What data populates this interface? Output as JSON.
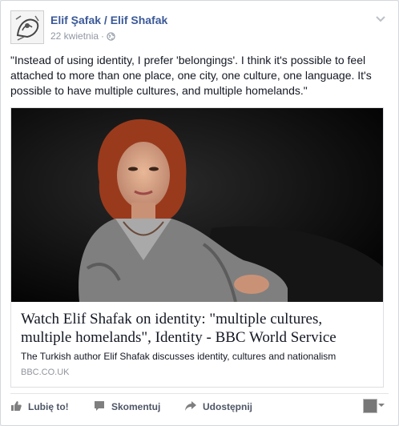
{
  "post": {
    "author": "Elif Şafak / Elif Shafak",
    "date": "22 kwietnia",
    "separator": "·",
    "privacy_icon": "globe-icon",
    "text": "\"Instead of using identity, I prefer 'belongings'. I think it's possible to feel attached to more than one place, one city, one culture, one language. It's possible to have multiple cultures, and multiple homelands.\""
  },
  "link": {
    "title": "Watch Elif Shafak on identity: \"multiple cultures, multiple homelands\", Identity - BBC World Service",
    "description": "The Turkish author Elif Shafak discusses identity, cultures and nationalism",
    "domain": "BBC.CO.UK"
  },
  "actions": {
    "like_label": "Lubię to!",
    "comment_label": "Skomentuj",
    "share_label": "Udostępnij"
  },
  "colors": {
    "author_link": "#3b5998",
    "meta_text": "#9197a3",
    "action_text": "#4e5665",
    "border": "#d3d6db"
  }
}
